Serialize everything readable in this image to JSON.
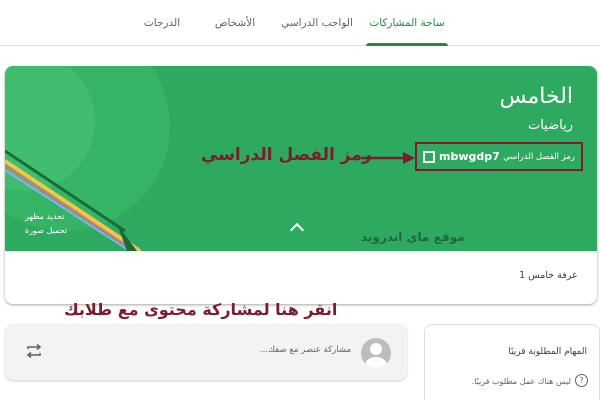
{
  "nav": {
    "tabs": [
      {
        "label": "ساحة المشاركات",
        "active": true
      },
      {
        "label": "الواجب الدراسي",
        "active": false
      },
      {
        "label": "الأشخاص",
        "active": false
      },
      {
        "label": "الدرجات",
        "active": false
      }
    ]
  },
  "banner": {
    "class_name": "الخامس",
    "subject": "رياضيات",
    "code_label": "رمز الفصل الدراسي",
    "code_value": "mbwgdp7",
    "select_theme": "تحديد مظهر",
    "upload_photo": "تحميل صورة",
    "watermark": "موقع ماي اندرويد",
    "room": "غرفة خامس 1"
  },
  "annotations": {
    "code": "رمز الفصل الدراسي",
    "share": "انقر هنا لمشاركة محتوى مع طلابك"
  },
  "composer": {
    "placeholder": "مشاركة عنصر مع صفك..."
  },
  "upcoming": {
    "title": "المهام المطلوبة قريبًا",
    "empty": "ليس هناك عمل مطلوب قريبًا."
  },
  "colors": {
    "accent": "#1e8e3e",
    "banner": "#2eaa60",
    "annotation": "#7b1d2e"
  },
  "icons": [
    "expand-icon",
    "chevron-up-icon",
    "repost-icon",
    "avatar-icon",
    "help-icon",
    "annotation-arrow-icon"
  ]
}
